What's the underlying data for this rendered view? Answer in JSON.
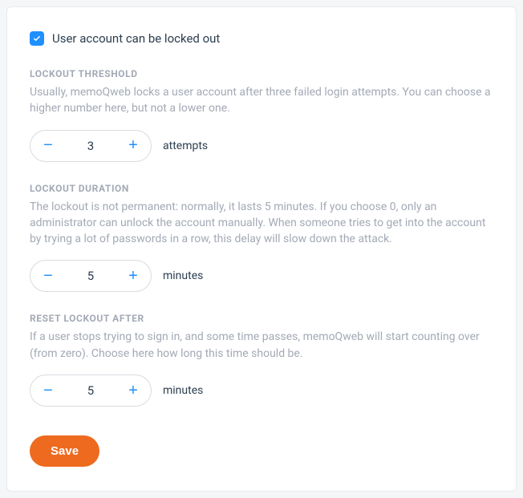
{
  "toggle": {
    "label": "User account can be locked out",
    "checked": true
  },
  "sections": {
    "threshold": {
      "heading": "LOCKOUT THRESHOLD",
      "desc": "Usually, memoQweb locks a user account after three failed login attempts. You can choose a higher number here, but not a lower one.",
      "value": "3",
      "unit": "attempts"
    },
    "duration": {
      "heading": "LOCKOUT DURATION",
      "desc": "The lockout is not permanent: normally, it lasts 5 minutes. If you choose 0, only an administrator can unlock the account manually. When someone tries to get into the account by trying a lot of passwords in a row, this delay will slow down the attack.",
      "value": "5",
      "unit": "minutes"
    },
    "reset": {
      "heading": "RESET LOCKOUT AFTER",
      "desc": "If a user stops trying to sign in, and some time passes, memoQweb will start counting over (from zero). Choose here how long this time should be.",
      "value": "5",
      "unit": "minutes"
    }
  },
  "actions": {
    "save_label": "Save"
  },
  "icons": {
    "minus": "−",
    "plus": "+"
  }
}
